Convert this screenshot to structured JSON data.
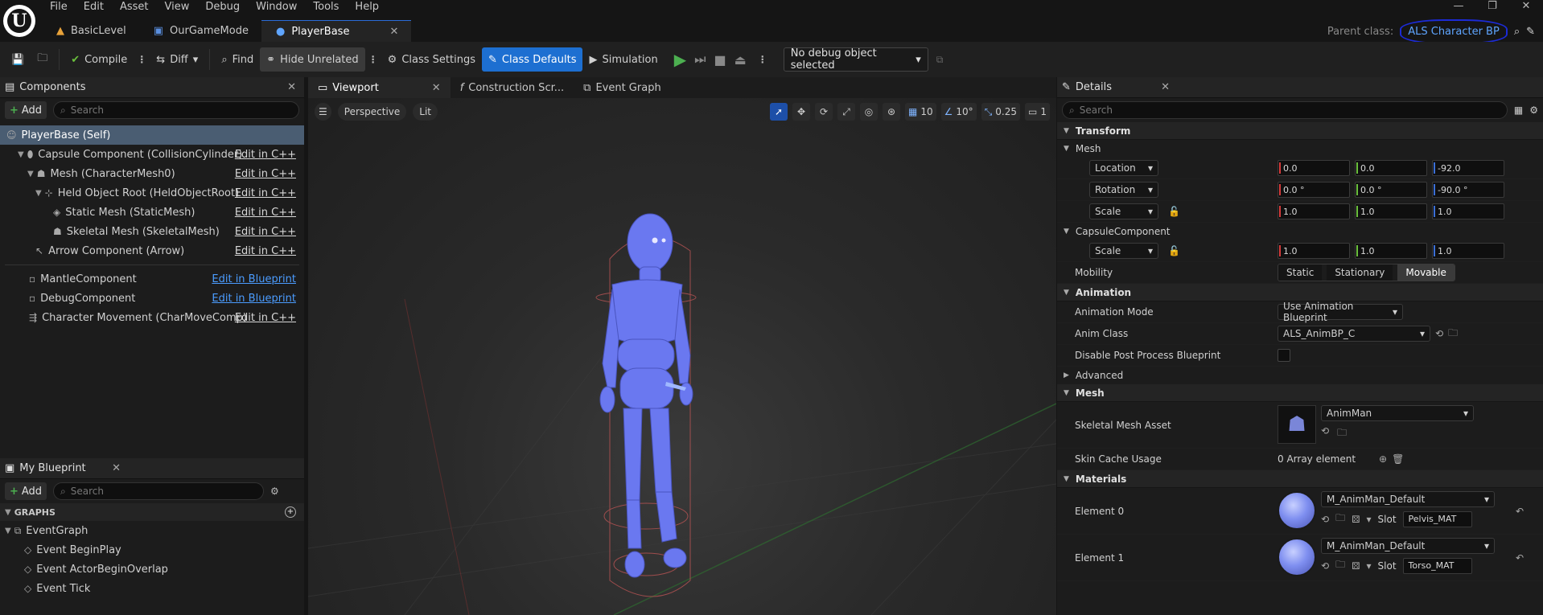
{
  "menu": [
    "File",
    "Edit",
    "Asset",
    "View",
    "Debug",
    "Window",
    "Tools",
    "Help"
  ],
  "doc_tabs": [
    {
      "label": "BasicLevel",
      "icon": "level-icon"
    },
    {
      "label": "OurGameMode",
      "icon": "blueprint-icon"
    },
    {
      "label": "PlayerBase",
      "icon": "character-icon"
    }
  ],
  "parent_class": {
    "label": "Parent class:",
    "value": "ALS Character BP"
  },
  "toolbar": {
    "compile": "Compile",
    "diff": "Diff",
    "find": "Find",
    "hide_unrelated": "Hide Unrelated",
    "class_settings": "Class Settings",
    "class_defaults": "Class Defaults",
    "simulation": "Simulation",
    "debug_object": "No debug object selected"
  },
  "components_panel": {
    "title": "Components",
    "add": "Add",
    "search_placeholder": "Search",
    "items": [
      {
        "label": "PlayerBase (Self)",
        "edit": ""
      },
      {
        "label": "Capsule Component (CollisionCylinder)",
        "edit": "Edit in C++"
      },
      {
        "label": "Mesh (CharacterMesh0)",
        "edit": "Edit in C++"
      },
      {
        "label": "Held Object Root (HeldObjectRoot)",
        "edit": "Edit in C++"
      },
      {
        "label": "Static Mesh (StaticMesh)",
        "edit": "Edit in C++"
      },
      {
        "label": "Skeletal Mesh (SkeletalMesh)",
        "edit": "Edit in C++"
      },
      {
        "label": "Arrow Component (Arrow)",
        "edit": "Edit in C++"
      },
      {
        "label": "MantleComponent",
        "edit": "Edit in Blueprint"
      },
      {
        "label": "DebugComponent",
        "edit": "Edit in Blueprint"
      },
      {
        "label": "Character Movement (CharMoveComp)",
        "edit": "Edit in C++"
      }
    ]
  },
  "my_blueprint": {
    "title": "My Blueprint",
    "add": "Add",
    "search_placeholder": "Search",
    "graphs_label": "GRAPHS",
    "event_graph": "EventGraph",
    "events": [
      "Event BeginPlay",
      "Event ActorBeginOverlap",
      "Event Tick"
    ]
  },
  "viewport_tabs": [
    "Viewport",
    "Construction Scr...",
    "Event Graph"
  ],
  "viewport_bar": {
    "perspective": "Perspective",
    "lit": "Lit",
    "grid_snap": "10",
    "rot_snap": "10°",
    "scale_snap": "0.25",
    "camera_speed": "1"
  },
  "details": {
    "title": "Details",
    "search_placeholder": "Search",
    "transform": "Transform",
    "mesh_sub": "Mesh",
    "location": {
      "label": "Location",
      "x": "0.0",
      "y": "0.0",
      "z": "-92.0"
    },
    "rotation": {
      "label": "Rotation",
      "x": "0.0 °",
      "y": "0.0 °",
      "z": "-90.0 °"
    },
    "scale": {
      "label": "Scale",
      "x": "1.0",
      "y": "1.0",
      "z": "1.0"
    },
    "capsule_sub": "CapsuleComponent",
    "capsule_scale": {
      "label": "Scale",
      "x": "1.0",
      "y": "1.0",
      "z": "1.0"
    },
    "mobility": {
      "label": "Mobility",
      "options": [
        "Static",
        "Stationary",
        "Movable"
      ],
      "selected": "Movable"
    },
    "animation": "Animation",
    "anim_mode": {
      "label": "Animation Mode",
      "value": "Use Animation Blueprint"
    },
    "anim_class": {
      "label": "Anim Class",
      "value": "ALS_AnimBP_C"
    },
    "disable_ppb": "Disable Post Process Blueprint",
    "advanced": "Advanced",
    "mesh_cat": "Mesh",
    "skel_mesh": {
      "label": "Skeletal Mesh Asset",
      "value": "AnimMan"
    },
    "skin_cache": {
      "label": "Skin Cache Usage",
      "value": "0 Array element"
    },
    "materials": "Materials",
    "element0": {
      "label": "Element 0",
      "material": "M_AnimMan_Default",
      "slot_label": "Slot",
      "slot": "Pelvis_MAT"
    },
    "element1": {
      "label": "Element 1",
      "material": "M_AnimMan_Default",
      "slot_label": "Slot",
      "slot": "Torso_MAT"
    }
  }
}
